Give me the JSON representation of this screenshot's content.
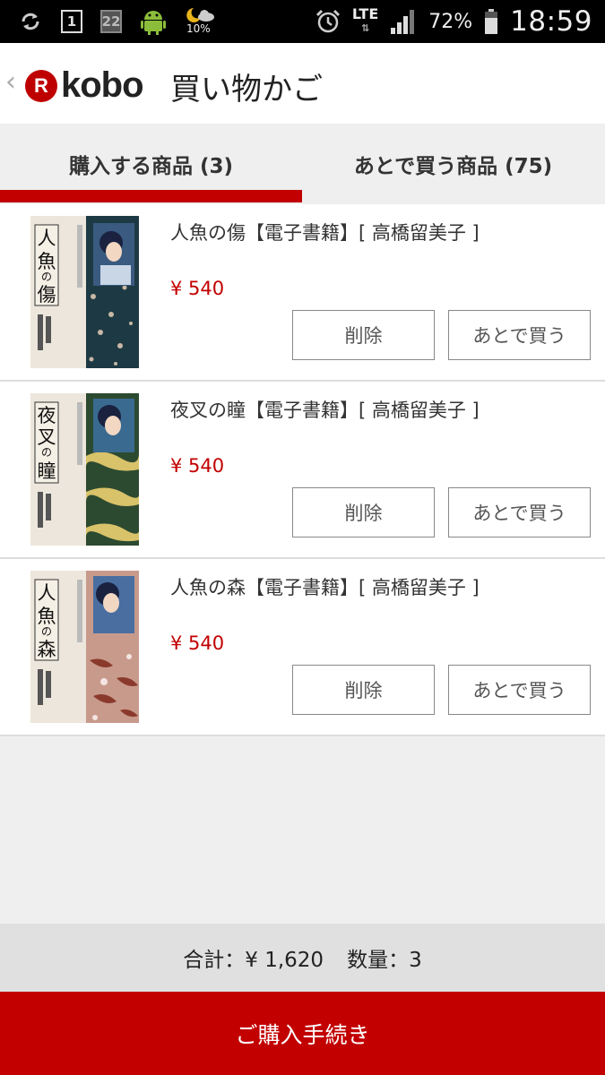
{
  "status_bar": {
    "icons_left": [
      "sync-icon",
      "calendar-icon",
      "calendar-icon",
      "android-icon",
      "weather-icon"
    ],
    "calendar_day": "1",
    "calendar_day_2": "22",
    "weather_percent": "10%",
    "network": "LTE",
    "battery_percent": "72%",
    "time": "18:59"
  },
  "header": {
    "logo_letter": "R",
    "logo_text": "kobo",
    "title": "買い物かご"
  },
  "tabs": [
    {
      "label": "購入する商品 (3)",
      "active": true
    },
    {
      "label": "あとで買う商品 (75)",
      "active": false
    }
  ],
  "items": [
    {
      "title": "人魚の傷【電子書籍】[ 高橋留美子 ]",
      "price": "¥ 540",
      "cover_text": "人魚の傷",
      "delete_label": "削除",
      "later_label": "あとで買う"
    },
    {
      "title": "夜叉の瞳【電子書籍】[ 高橋留美子 ]",
      "price": "¥ 540",
      "cover_text": "夜叉の瞳",
      "delete_label": "削除",
      "later_label": "あとで買う"
    },
    {
      "title": "人魚の森【電子書籍】[ 高橋留美子 ]",
      "price": "¥ 540",
      "cover_text": "人魚の森",
      "delete_label": "削除",
      "later_label": "あとで買う"
    }
  ],
  "summary": {
    "total": "合計：¥ 1,620",
    "quantity": "数量：3"
  },
  "checkout_label": "ご購入手続き",
  "colors": {
    "accent": "#c20000",
    "status_bar": "#000000"
  }
}
